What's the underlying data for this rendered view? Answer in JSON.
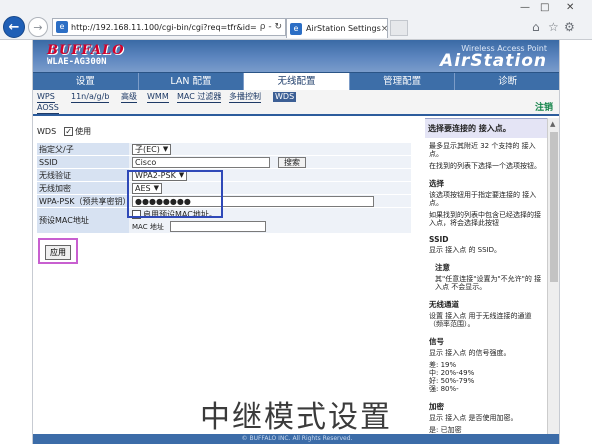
{
  "browser": {
    "url": "http://192.168.11.100/cgi-bin/cgi?req=tfr&id=14&rar",
    "addr_controls": "ρ - ↻",
    "tab_title": "AirStation Settings",
    "tab_close": "×",
    "back_icon": "←",
    "forward_icon": "→",
    "home_icon": "⌂",
    "star_icon": "☆",
    "gear_icon": "⚙",
    "win_min": "—",
    "win_max": "□",
    "win_close": "✕"
  },
  "banner": {
    "logo": "BUFFALO",
    "model": "WLAE-AG300N",
    "tagline": "Wireless Access Point",
    "brand": "AirStation"
  },
  "menu": [
    {
      "label": "设置",
      "active": false
    },
    {
      "label": "LAN 配置",
      "active": false
    },
    {
      "label": "无线配置",
      "active": true
    },
    {
      "label": "管理配置",
      "active": false
    },
    {
      "label": "诊断",
      "active": false
    }
  ],
  "submenu": {
    "wps": "WPS",
    "bgn": "11n/a/g/b",
    "advanced": "高级",
    "wmm": "WMM",
    "mac_filter": "MAC 过滤器",
    "multicast": "多播控制",
    "wds": "WDS",
    "aoss": "AOSS"
  },
  "logout": "注销",
  "form": {
    "wds_label": "WDS",
    "wds_enable": "使用",
    "rows": {
      "role_label": "指定父/子",
      "role_value": "子(EC)",
      "ssid_label": "SSID",
      "ssid_value": "Cisco",
      "search_button": "搜索",
      "auth_label": "无线验证",
      "auth_value": "WPA2-PSK",
      "enc_label": "无线加密",
      "enc_value": "AES",
      "psk_label": "WPA-PSK（预共享密钥）",
      "psk_value": "●●●●●●●●",
      "mac_label": "预设MAC地址",
      "mac_enable": "启用预设MAC地址。",
      "mac_addr_label": "MAC 地址",
      "mac_addr_value": ""
    },
    "apply_button": "应用"
  },
  "help": {
    "title": "选择要连接的 接入点。",
    "intro1": "最多显示其附近 32 个支持的 接入点。",
    "intro2": "在找到的列表下选择一个选项按钮。",
    "select_head": "选择",
    "select_text1": "该选项按钮用于指定要连接的 接入点。",
    "select_text2": "如果找到的列表中包含已经选择的接入点，将会选择此按钮",
    "ssid_head": "SSID",
    "ssid_text": "显示 接入点 的 SSID。",
    "note_head": "注意",
    "note_text": "其\"任意连接\"设置为\"不允许\"的 接入点 不会显示。",
    "channel_head": "无线通道",
    "channel_text": "设置 接入点 用于无线连接的通道（频率范围）。",
    "signal_head": "信号",
    "signal_text1": "显示 接入点 的信号强度。",
    "signal_levels": [
      "差: 19%",
      "中: 20%-49%",
      "好: 50%-79%",
      "强: 80%-"
    ],
    "encrypt_head": "加密",
    "encrypt_text1": "显示 接入点 是否使用加密。",
    "encrypt_text2": "是: 已加密"
  },
  "footer": "© BUFFALO INC. All Rights Reserved.",
  "caption": "中继模式设置"
}
